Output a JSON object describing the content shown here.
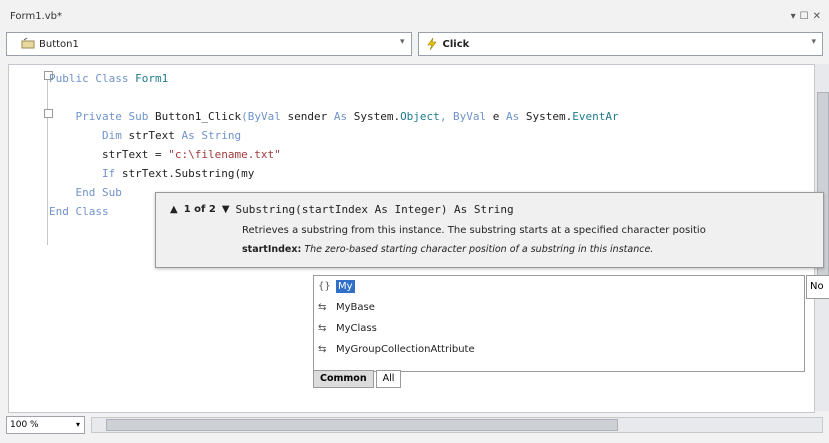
{
  "window": {
    "tab_title": "Form1.vb*",
    "controls": [
      "▾",
      "☐",
      "✕"
    ]
  },
  "navigation": {
    "object_combo": "Button1",
    "event_combo": "Click"
  },
  "code": {
    "line1_kw": "Public Class",
    "line1_name": "Form1",
    "line3_kw": "Private Sub",
    "line3_name": "Button1_Click",
    "line3_params_a": "(ByVal",
    "line3_params_b": "sender",
    "line3_params_c": "As",
    "line3_params_d": "System.",
    "line3_params_e": "Object",
    "line3_params_f": ", ByVal",
    "line3_params_g": "e",
    "line3_params_h": "As",
    "line3_params_i": "System.",
    "line3_params_j": "EventAr",
    "line4_kw": "Dim",
    "line4_var": "strText",
    "line4_as": "As",
    "line4_type": "String",
    "line5_var": "strText =",
    "line5_str": "\"c:\\filename.txt\"",
    "line6_kw": "If",
    "line6_rest": "strText.Substring(my",
    "line7": "End Sub",
    "line8": "End Class"
  },
  "param_info": {
    "counter": "1 of 2",
    "signature": "Substring(startIndex As Integer) As String",
    "description": "Retrieves a substring from this instance. The substring starts at a specified character positio",
    "param_name": "startIndex:",
    "param_desc": "The zero-based starting character position of a substring in this instance."
  },
  "completion": {
    "items": [
      {
        "glyph": "{}",
        "label": "My"
      },
      {
        "glyph": "⇆",
        "label": "MyBase"
      },
      {
        "glyph": "⇆",
        "label": "MyClass"
      },
      {
        "glyph": "⇆",
        "label": "MyGroupCollectionAttribute"
      }
    ],
    "tabs": [
      "Common",
      "All"
    ],
    "side_tip": "No"
  },
  "status": {
    "zoom": "100 %"
  }
}
